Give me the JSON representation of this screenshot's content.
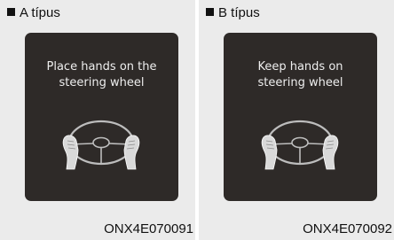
{
  "panels": [
    {
      "type_label": "A típus",
      "message_lines": [
        "Place hands on the",
        "steering wheel"
      ],
      "caption": "ONX4E070091"
    },
    {
      "type_label": "B típus",
      "message_lines": [
        "Keep hands on",
        "steering wheel"
      ],
      "caption": "ONX4E070092"
    }
  ],
  "icons": {
    "bullet": "black-square-bullet",
    "illustration": "hands-on-steering-wheel-icon"
  },
  "colors": {
    "screen_background": "#2e2a28",
    "screen_text": "#eeeeee",
    "panel_background": "#ebebeb"
  }
}
